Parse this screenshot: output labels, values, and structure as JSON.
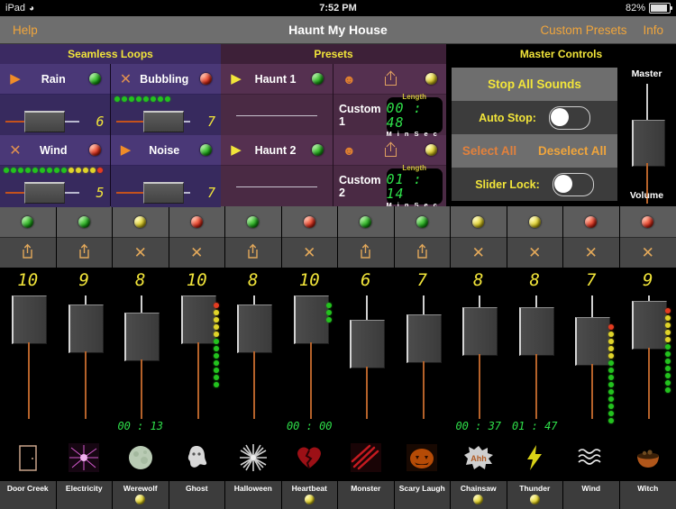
{
  "statusbar": {
    "device": "iPad",
    "wifi_icon": "wifi-icon",
    "time": "7:52 PM",
    "battery_pct": "82%"
  },
  "navbar": {
    "help": "Help",
    "title": "Haunt My House",
    "custom_presets": "Custom Presets",
    "info": "Info"
  },
  "sections": {
    "loops": "Seamless Loops",
    "presets": "Presets",
    "master": "Master Controls"
  },
  "loops": [
    {
      "name": "Rain",
      "state_icon": "play-icon",
      "lamp": "green",
      "value": "6",
      "knob_pct": 32,
      "leds": []
    },
    {
      "name": "Bubbling",
      "state_icon": "close-icon",
      "lamp": "red",
      "value": "7",
      "knob_pct": 46,
      "leds": [
        "g",
        "g",
        "g",
        "g",
        "g",
        "g",
        "g",
        "g"
      ]
    },
    {
      "name": "Wind",
      "state_icon": "close-icon",
      "lamp": "red",
      "value": "5",
      "knob_pct": 32,
      "leds": [
        "g",
        "g",
        "g",
        "g",
        "g",
        "g",
        "g",
        "g",
        "g",
        "y",
        "y",
        "y",
        "y",
        "r"
      ]
    },
    {
      "name": "Noise",
      "state_icon": "play-icon",
      "lamp": "green",
      "value": "7",
      "knob_pct": 46,
      "leds": []
    }
  ],
  "presets": [
    {
      "name": "Haunt 1",
      "state_icon": "play-icon",
      "lamp": "green"
    },
    {
      "name": "Haunt 2",
      "state_icon": "play-icon",
      "lamp": "green"
    }
  ],
  "custom_presets": [
    {
      "name": "Custom 1",
      "pumpkin_icon": "pumpkin-icon",
      "share_icon": "share-icon",
      "lamp": "yellow",
      "length_label": "Length",
      "min": "00",
      "sec": "48",
      "min_unit": "Min",
      "sec_unit": "Sec"
    },
    {
      "name": "Custom 2",
      "pumpkin_icon": "pumpkin-icon",
      "share_icon": "share-icon",
      "lamp": "yellow",
      "length_label": "Length",
      "min": "01",
      "sec": "14",
      "min_unit": "Min",
      "sec_unit": "Sec"
    }
  ],
  "master": {
    "stop_all": "Stop All Sounds",
    "auto_stop_label": "Auto Stop:",
    "auto_stop_on": false,
    "select_all": "Select All",
    "deselect_all": "Deselect All",
    "slider_lock_label": "Slider Lock:",
    "slider_lock_on": false,
    "volume_top_label": "Master",
    "volume_bottom_label": "Volume",
    "volume_knob_pct": 48
  },
  "channels": [
    {
      "name": "Door Creek",
      "art_icon": "door-icon",
      "lamp": "green",
      "action_icon": "share-icon",
      "value": "10",
      "knob_pct": 100,
      "time": "",
      "meter": [],
      "sound_lamp": "none"
    },
    {
      "name": "Electricity",
      "art_icon": "electricity-icon",
      "lamp": "green",
      "action_icon": "share-icon",
      "value": "9",
      "knob_pct": 88,
      "time": "",
      "meter": [],
      "sound_lamp": "none"
    },
    {
      "name": "Werewolf",
      "art_icon": "moon-icon",
      "lamp": "yellow",
      "action_icon": "close-icon",
      "value": "8",
      "knob_pct": 76,
      "time": "00 : 13",
      "meter": [],
      "sound_lamp": "yellow"
    },
    {
      "name": "Ghost",
      "art_icon": "ghost-icon",
      "lamp": "red",
      "action_icon": "close-icon",
      "value": "10",
      "knob_pct": 100,
      "time": "",
      "meter": [
        "r",
        "y",
        "y",
        "y",
        "y",
        "g",
        "g",
        "g",
        "g",
        "g",
        "g",
        "g"
      ],
      "sound_lamp": "none"
    },
    {
      "name": "Halloween",
      "art_icon": "snowflake-star-icon",
      "lamp": "green",
      "action_icon": "share-icon",
      "value": "8",
      "knob_pct": 88,
      "time": "",
      "meter": [],
      "sound_lamp": "none"
    },
    {
      "name": "Heartbeat",
      "art_icon": "broken-heart-icon",
      "lamp": "red",
      "action_icon": "close-icon",
      "value": "10",
      "knob_pct": 100,
      "time": "00 : 00",
      "meter": [
        "g",
        "g",
        "g"
      ],
      "sound_lamp": "yellow"
    },
    {
      "name": "Monster",
      "art_icon": "claw-icon",
      "lamp": "green",
      "action_icon": "share-icon",
      "value": "6",
      "knob_pct": 66,
      "time": "",
      "meter": [],
      "sound_lamp": "none"
    },
    {
      "name": "Scary Laugh",
      "art_icon": "jackolantern-icon",
      "lamp": "green",
      "action_icon": "share-icon",
      "value": "7",
      "knob_pct": 74,
      "time": "",
      "meter": [],
      "sound_lamp": "none"
    },
    {
      "name": "Chainsaw",
      "art_icon": "ahh-burst-icon",
      "lamp": "yellow",
      "action_icon": "close-icon",
      "value": "8",
      "knob_pct": 84,
      "time": "00 : 37",
      "meter": [],
      "sound_lamp": "yellow"
    },
    {
      "name": "Thunder",
      "art_icon": "lightning-icon",
      "lamp": "yellow",
      "action_icon": "close-icon",
      "value": "8",
      "knob_pct": 84,
      "time": "01 : 47",
      "meter": [],
      "sound_lamp": "yellow"
    },
    {
      "name": "Wind",
      "art_icon": "waves-icon",
      "lamp": "red",
      "action_icon": "close-icon",
      "value": "7",
      "knob_pct": 70,
      "time": "",
      "meter": [
        "r",
        "y",
        "y",
        "y",
        "y",
        "g",
        "g",
        "g",
        "g",
        "g",
        "g",
        "g",
        "g",
        "g"
      ],
      "sound_lamp": "none"
    },
    {
      "name": "Witch",
      "art_icon": "cauldron-icon",
      "lamp": "red",
      "action_icon": "close-icon",
      "value": "9",
      "knob_pct": 92,
      "time": "",
      "meter": [
        "r",
        "y",
        "y",
        "y",
        "y",
        "g",
        "g",
        "g",
        "g",
        "g",
        "g",
        "g"
      ],
      "sound_lamp": "none"
    }
  ],
  "colors": {
    "accent_orange": "#f0a53c",
    "accent_yellow": "#f2e53a",
    "led_green": "#23c21e",
    "led_red": "#e43c20",
    "loops_bg": "#3b2a62",
    "presets_bg": "#3d2038"
  }
}
